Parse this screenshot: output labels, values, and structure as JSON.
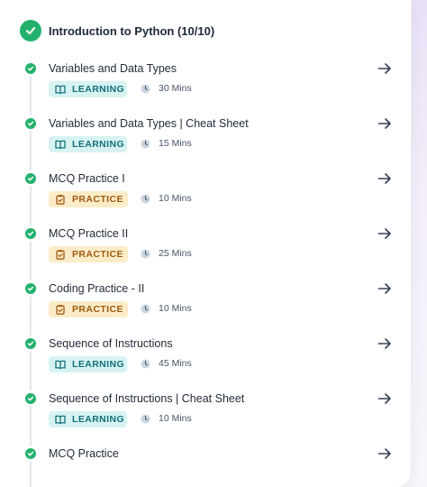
{
  "module": {
    "title": "Introduction to Python (10/10)",
    "status_color": "#23b26d",
    "icon": "check-circle-icon"
  },
  "lessons": [
    {
      "title": "Variables and Data Types",
      "tag": "LEARNING",
      "tag_icon": "book-icon",
      "duration": "30 Mins",
      "completed": true
    },
    {
      "title": "Variables and Data Types | Cheat Sheet",
      "tag": "LEARNING",
      "tag_icon": "book-icon",
      "duration": "15 Mins",
      "completed": true
    },
    {
      "title": "MCQ Practice I",
      "tag": "PRACTICE",
      "tag_icon": "clipboard-icon",
      "duration": "10 Mins",
      "completed": true
    },
    {
      "title": "MCQ Practice II",
      "tag": "PRACTICE",
      "tag_icon": "clipboard-icon",
      "duration": "25 Mins",
      "completed": true
    },
    {
      "title": "Coding Practice - II",
      "tag": "PRACTICE",
      "tag_icon": "clipboard-icon",
      "duration": "10 Mins",
      "completed": true
    },
    {
      "title": "Sequence of Instructions",
      "tag": "LEARNING",
      "tag_icon": "book-icon",
      "duration": "45 Mins",
      "completed": true
    },
    {
      "title": "Sequence of Instructions | Cheat Sheet",
      "tag": "LEARNING",
      "tag_icon": "book-icon",
      "duration": "10 Mins",
      "completed": true
    },
    {
      "title": "MCQ Practice",
      "tag": "",
      "tag_icon": "",
      "duration": "",
      "completed": true
    }
  ],
  "colors": {
    "learning_bg": "#d6f3f2",
    "learning_text": "#13707a",
    "practice_bg": "#fbecc8",
    "practice_text": "#a05a10"
  },
  "icons": {
    "arrow": "arrow-right-icon",
    "clock": "clock-icon"
  }
}
